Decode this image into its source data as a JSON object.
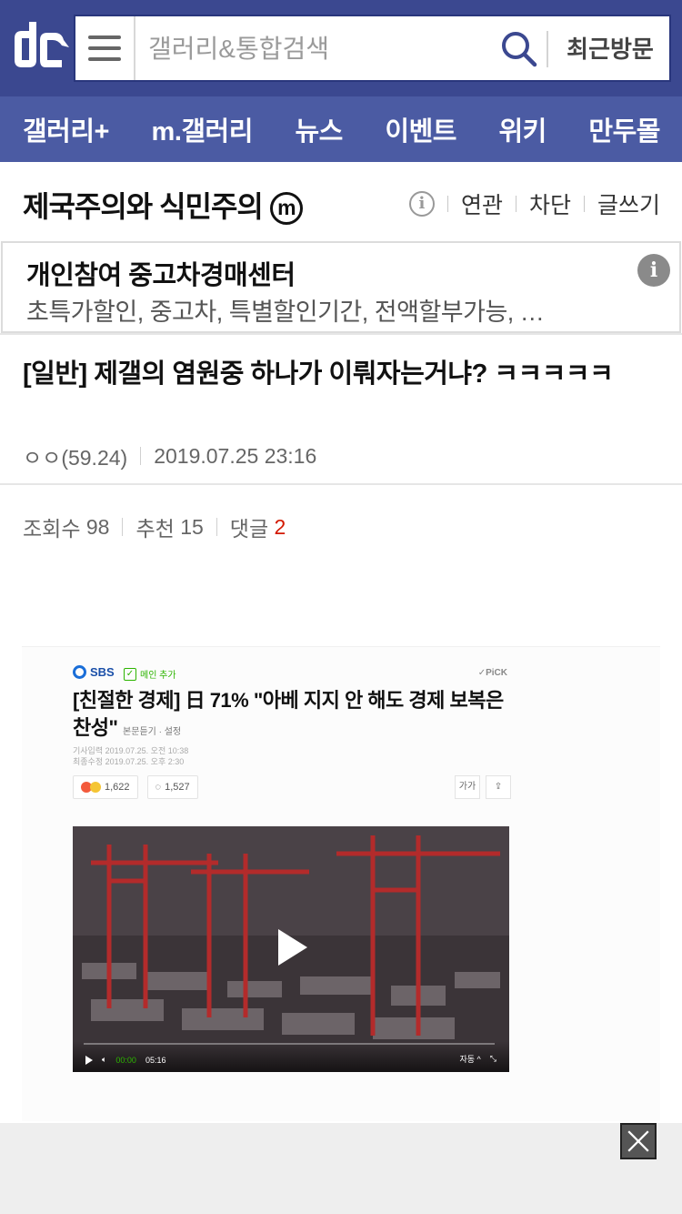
{
  "header": {
    "logo_alt": "dc",
    "search_placeholder": "갤러리&통합검색",
    "recent_label": "최근방문"
  },
  "nav": {
    "items": [
      {
        "label": "갤러리+"
      },
      {
        "label": "m.갤러리"
      },
      {
        "label": "뉴스"
      },
      {
        "label": "이벤트"
      },
      {
        "label": "위키"
      },
      {
        "label": "만두몰"
      }
    ]
  },
  "gallery": {
    "title": "제국주의와 식민주의",
    "badge": "m",
    "tools": {
      "related": "연관",
      "block": "차단",
      "write": "글쓰기"
    }
  },
  "ad": {
    "title": "개인참여 중고차경매센터",
    "description": "초특가할인, 중고차, 특별할인기간, 전액할부가능, …",
    "info": "i"
  },
  "post": {
    "title": "[일반] 제갤의 염원중 하나가 이뤄자는거냐? ㅋㅋㅋㅋㅋ",
    "author": "ㅇㅇ(59.24)",
    "datetime": "2019.07.25 23:16",
    "views_label": "조회수",
    "views": "98",
    "recommend_label": "추천",
    "recommend": "15",
    "comments_label": "댓글",
    "comments": "2"
  },
  "embedded_article": {
    "source": "SBS",
    "main_add": "메인 추가",
    "pick": "✓PiCK",
    "headline": "[친절한 경제] 日 71% \"아베 지지 안 해도 경제 보복은 찬성\"",
    "listen": "본문듣기 · 설정",
    "published": "기사입력  2019.07.25. 오전 10:38",
    "modified": "최종수정  2019.07.25. 오후 2:30",
    "reactions": "1,622",
    "comments": "1,527",
    "font_tool": "가가",
    "video_current": "00:00",
    "video_total": "05:16",
    "video_auto": "자동 ^"
  },
  "colors": {
    "header_bg": "#3b4890",
    "nav_bg": "#4b5ba3",
    "comment_count": "#d31900"
  }
}
